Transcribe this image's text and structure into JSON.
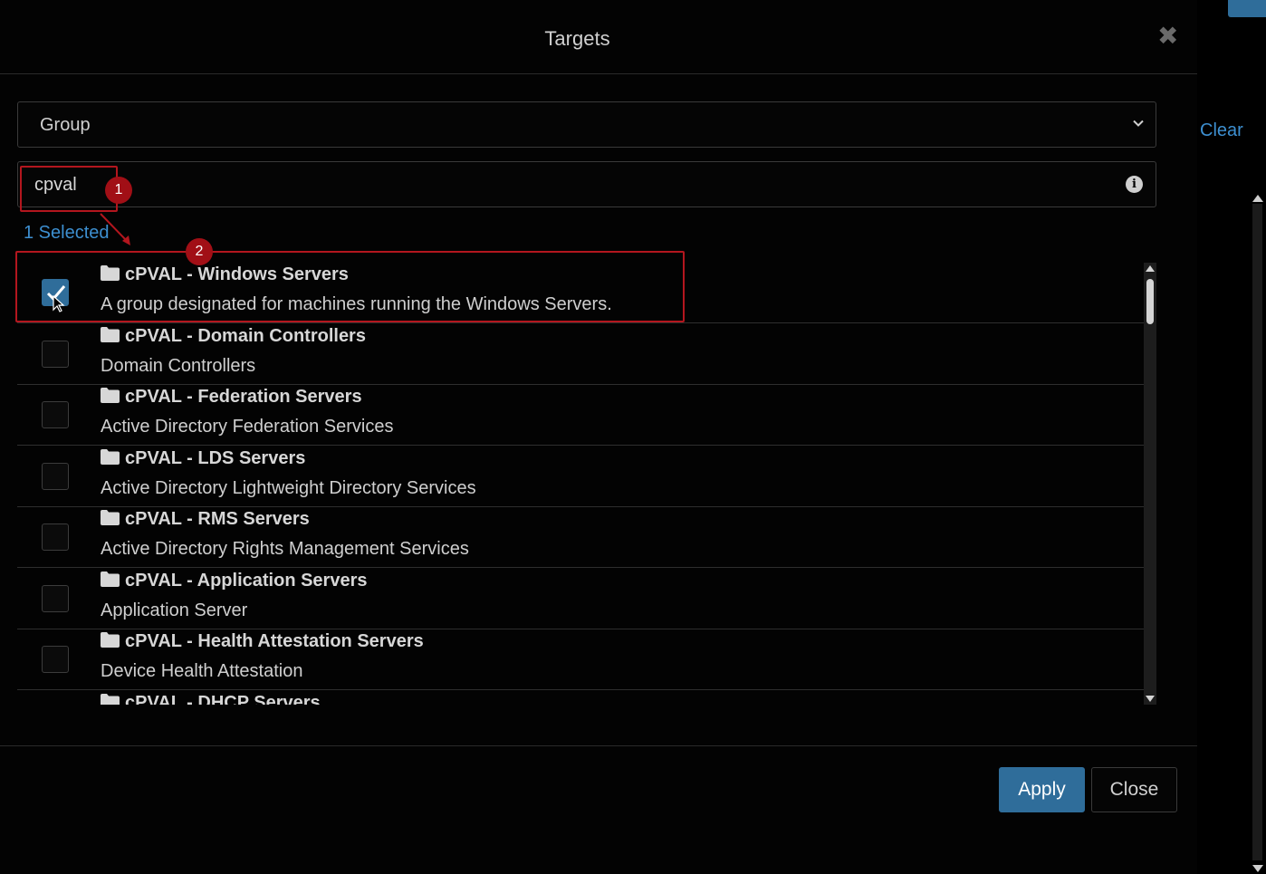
{
  "modal": {
    "title": "Targets",
    "close_glyph": "✖",
    "type_select": {
      "value": "Group"
    },
    "search": {
      "value": "cpval"
    },
    "selected_count": "1 Selected",
    "items": [
      {
        "title": "cPVAL - Windows Servers",
        "description": "A group designated for machines running the Windows Servers.",
        "checked": true
      },
      {
        "title": "cPVAL - Domain Controllers",
        "description": "Domain Controllers",
        "checked": false
      },
      {
        "title": "cPVAL - Federation Servers",
        "description": "Active Directory Federation Services",
        "checked": false
      },
      {
        "title": "cPVAL - LDS Servers",
        "description": "Active Directory Lightweight Directory Services",
        "checked": false
      },
      {
        "title": "cPVAL - RMS Servers",
        "description": "Active Directory Rights Management Services",
        "checked": false
      },
      {
        "title": "cPVAL - Application Servers",
        "description": "Application Server",
        "checked": false
      },
      {
        "title": "cPVAL - Health Attestation Servers",
        "description": "Device Health Attestation",
        "checked": false
      },
      {
        "title": "cPVAL - DHCP Servers",
        "description": "",
        "checked": false
      }
    ],
    "footer": {
      "apply_label": "Apply",
      "close_label": "Close"
    }
  },
  "background": {
    "clear_label": "Clear"
  },
  "annotations": {
    "badge_1": "1",
    "badge_2": "2"
  },
  "colors": {
    "accent": "#2f6d9a",
    "link": "#3d8fd0",
    "annotation": "#b3161e"
  },
  "icons": [
    "chevron-down-icon",
    "info-icon",
    "folder-icon",
    "checkmark-icon",
    "close-icon",
    "mouse-cursor-icon"
  ]
}
